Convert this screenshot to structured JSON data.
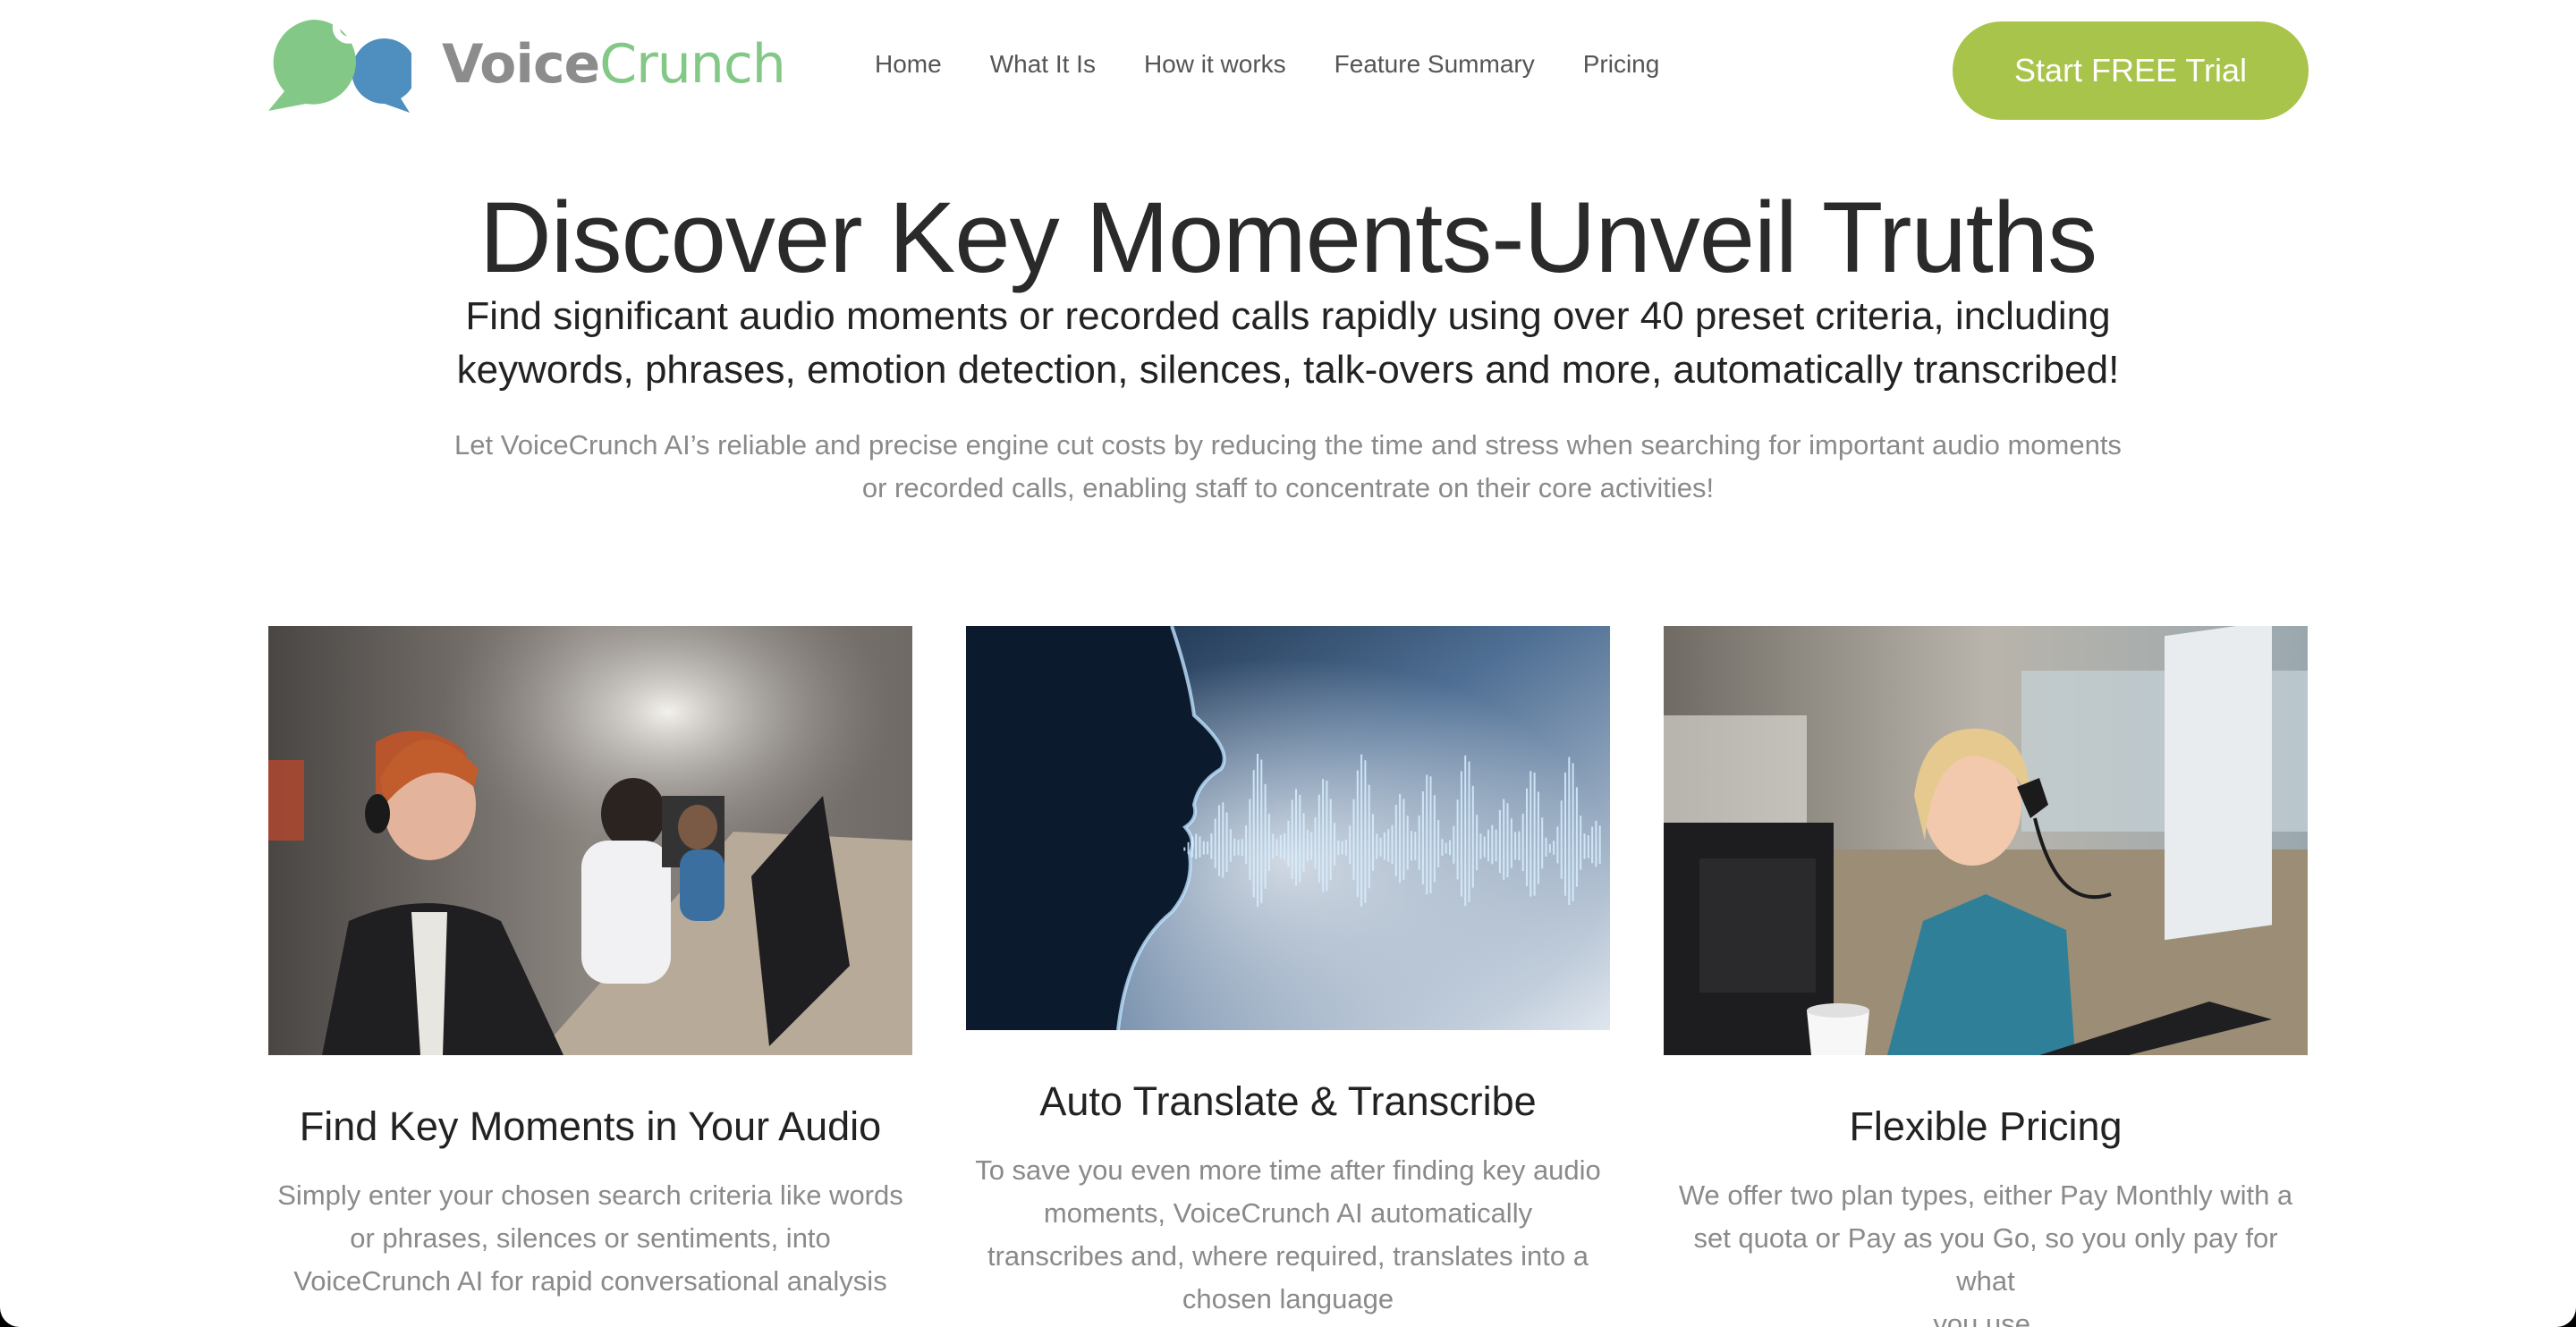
{
  "header": {
    "logo": {
      "part1": "Voice",
      "part2": "Crunch"
    },
    "nav": [
      "Home",
      "What It Is",
      "How it works",
      "Feature Summary",
      "Pricing"
    ],
    "cta_label": "Start FREE Trial"
  },
  "hero": {
    "title": "Discover Key Moments-Unveil Truths",
    "subtitle_line1": "Find significant audio moments or recorded calls rapidly using over 40 preset criteria, including",
    "subtitle_line2": "keywords, phrases, emotion detection, silences, talk-overs and more, automatically transcribed!",
    "body_line1": "Let VoiceCrunch AI’s reliable and precise engine cut costs by reducing the time and stress when searching for important audio moments",
    "body_line2": "or recorded calls, enabling staff to concentrate on their core activities!"
  },
  "cards": [
    {
      "title": "Find Key Moments in Your Audio",
      "lines": [
        "Simply enter your chosen search criteria like words",
        "or phrases, silences or sentiments, into",
        "VoiceCrunch AI for rapid conversational analysis"
      ]
    },
    {
      "title": "Auto Translate & Transcribe",
      "lines": [
        "To save you even more time after finding key audio",
        "moments, VoiceCrunch AI automatically",
        "transcribes and, where required, translates into a",
        "chosen language"
      ]
    },
    {
      "title": "Flexible Pricing",
      "lines": [
        "We offer two plan types, either Pay Monthly with a",
        "set quota or Pay as you Go, so you only pay for what",
        "you use."
      ]
    }
  ],
  "colors": {
    "brand_green": "#83c886",
    "brand_blue": "#4e8fbf",
    "cta_bg": "#a9c44a",
    "muted_text": "#8a8a8a"
  }
}
